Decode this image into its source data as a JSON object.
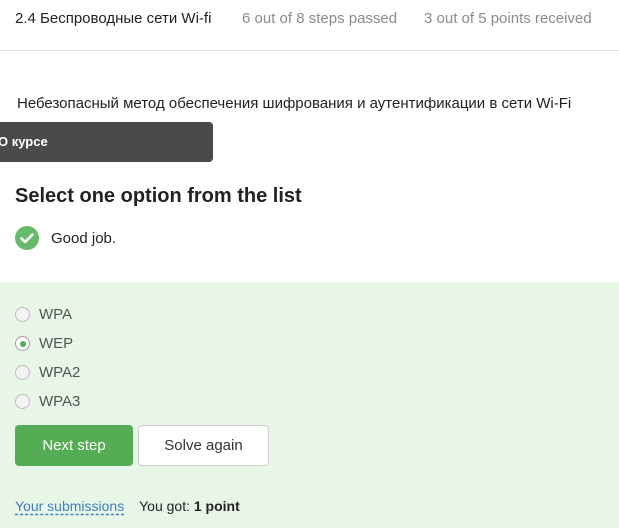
{
  "header": {
    "title": "2.4 Беспроводные сети Wi-fi",
    "steps": "6 out of 8 steps passed",
    "points": "3 out of 5 points  received"
  },
  "question": "Небезопасный метод обеспечения шифрования и аутентификации в сети Wi-Fi",
  "tooltip": "О курсе",
  "prompt": "Select one option from the list",
  "feedback": {
    "message": "Good job.",
    "status_color": "#66bb6a"
  },
  "options": [
    {
      "label": "WPA",
      "checked": false
    },
    {
      "label": "WEP",
      "checked": true
    },
    {
      "label": "WPA2",
      "checked": false
    },
    {
      "label": "WPA3",
      "checked": false
    }
  ],
  "buttons": {
    "next": "Next step",
    "again": "Solve again"
  },
  "bottom": {
    "submissions_link": "Your submissions",
    "got_prefix": "You got: ",
    "got_value": "1 point"
  },
  "colors": {
    "accent": "#54ad54",
    "answer_bg": "#e8f6e8",
    "link": "#3f7fc1"
  }
}
